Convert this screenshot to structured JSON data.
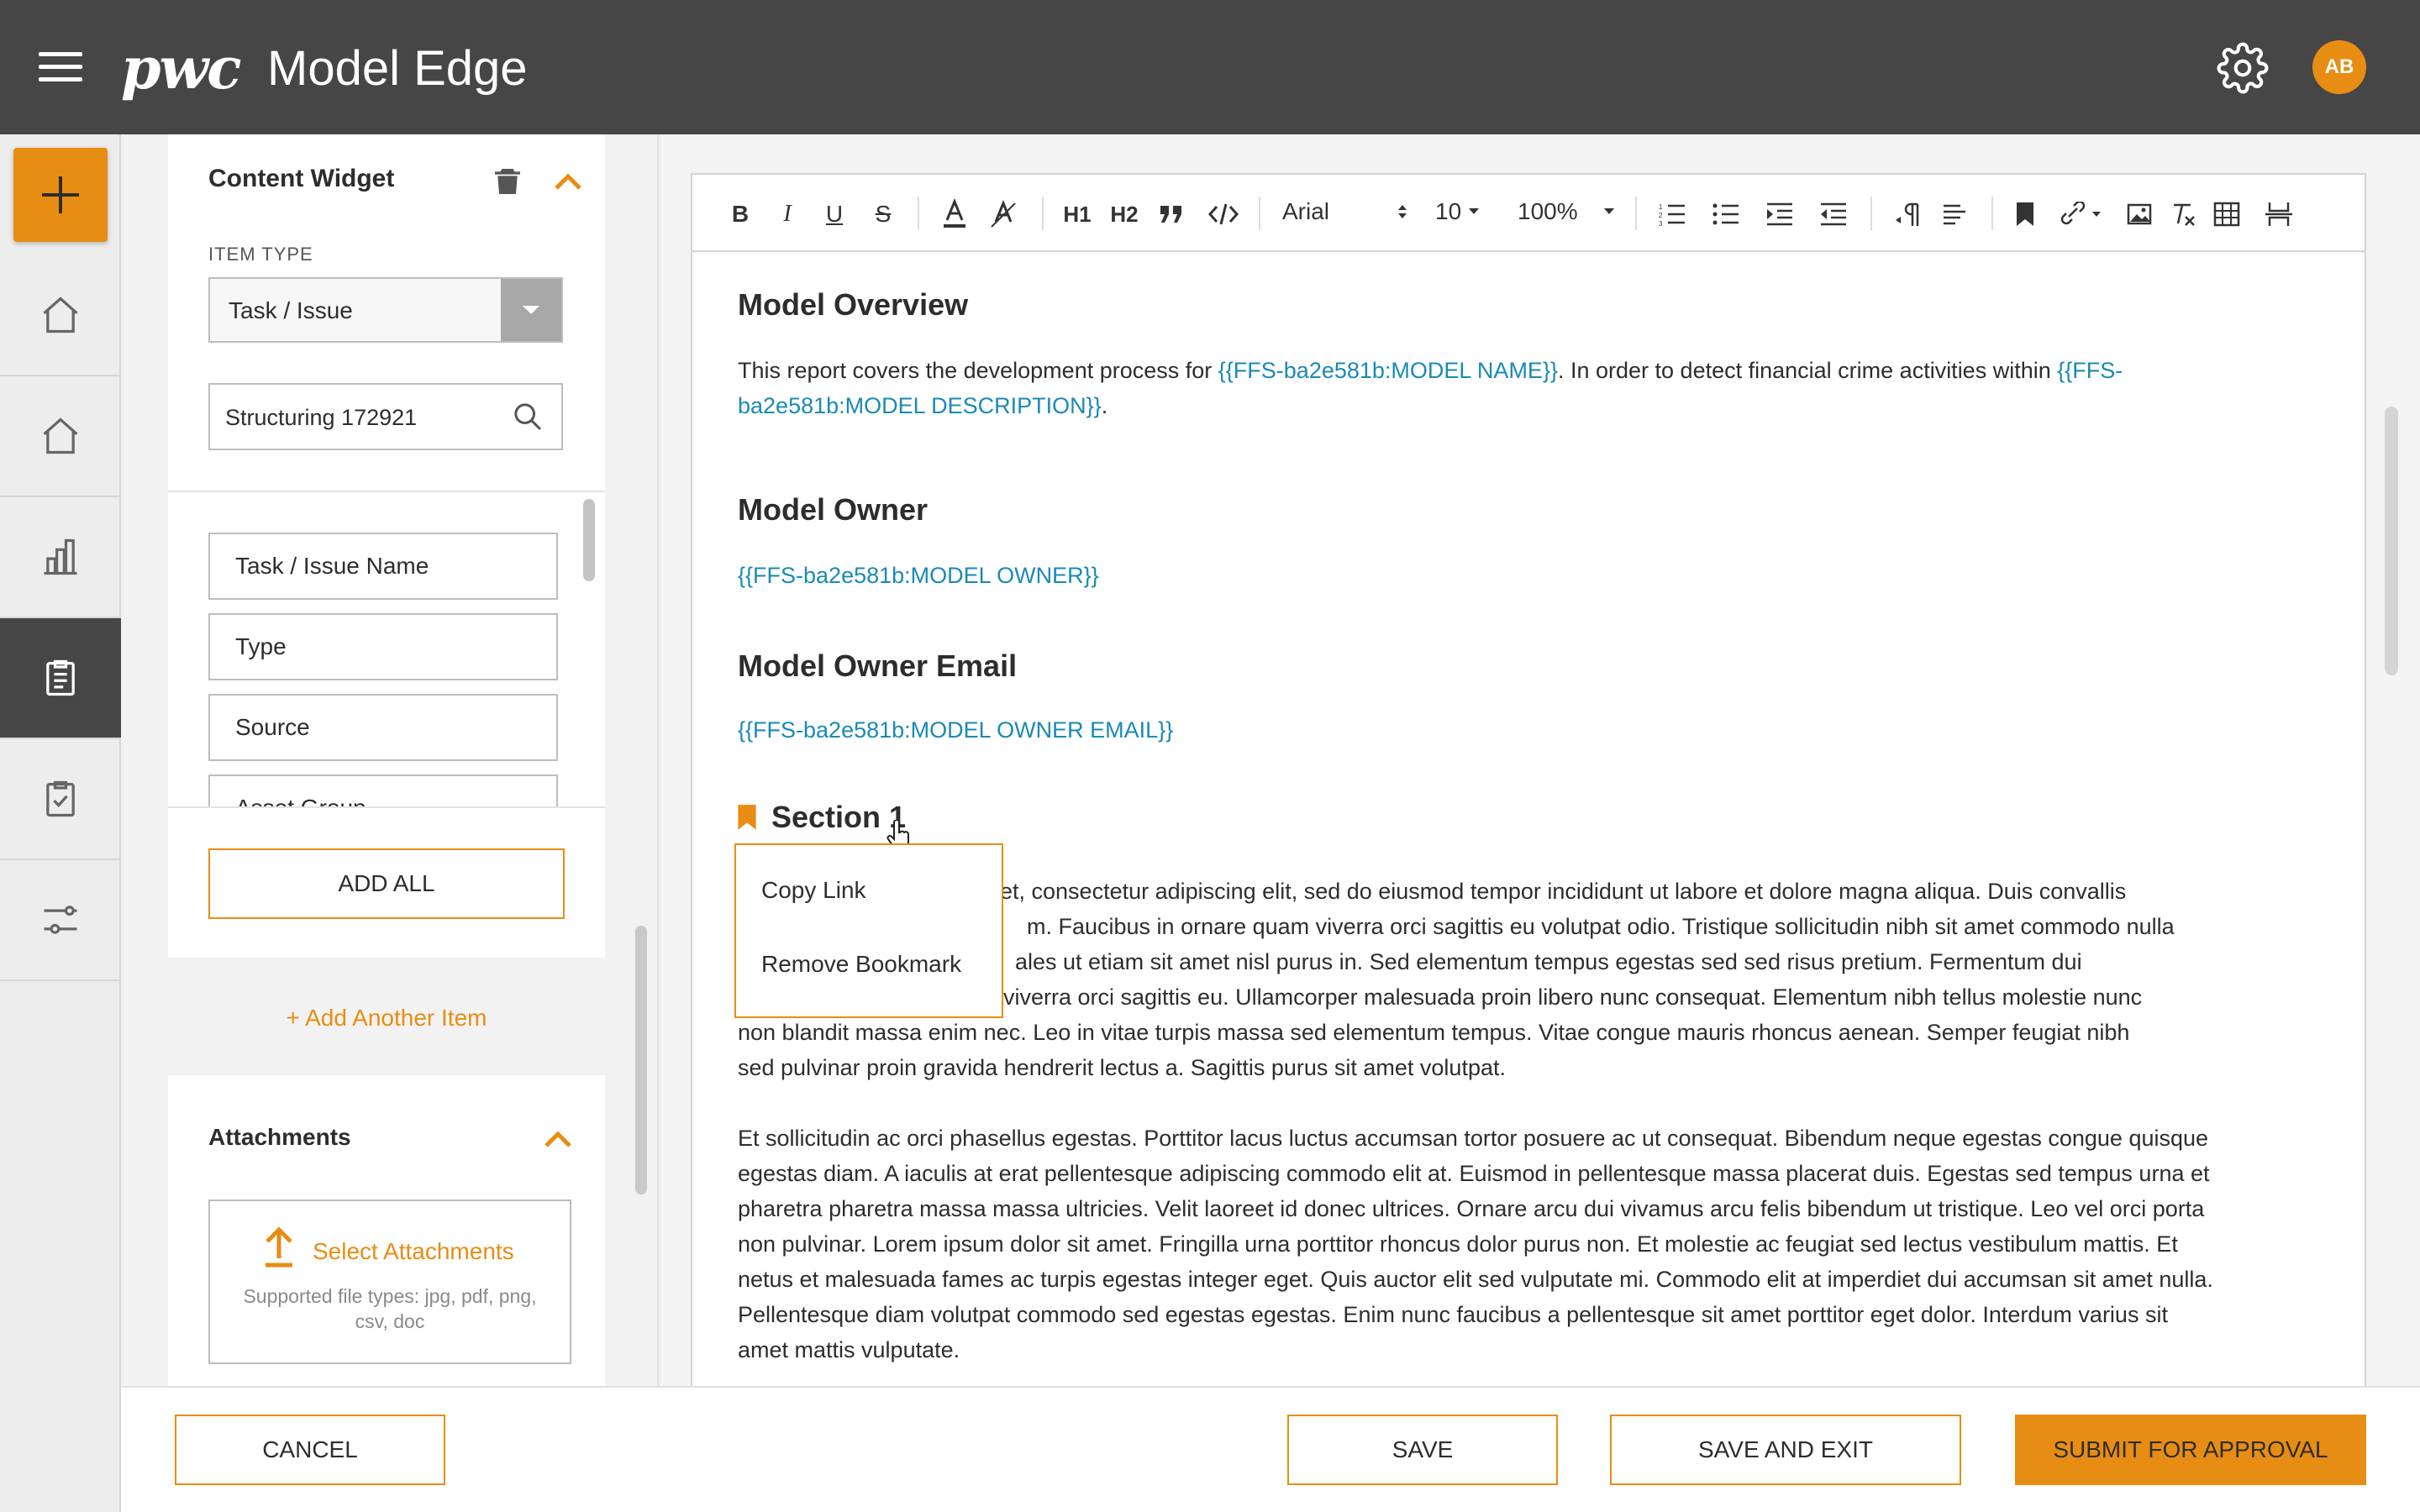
{
  "app": {
    "brand": "pwc",
    "title": "Model Edge",
    "user_initials": "AB",
    "accent": "#e88d14",
    "topbar_color": "#464646"
  },
  "nav": {
    "items": [
      {
        "icon": "plus-icon"
      },
      {
        "icon": "home-icon"
      },
      {
        "icon": "home-outline-icon"
      },
      {
        "icon": "bar-chart-icon"
      },
      {
        "icon": "clipboard-icon",
        "active": true
      },
      {
        "icon": "clipboard-check-icon"
      },
      {
        "icon": "sliders-icon"
      }
    ]
  },
  "widget": {
    "title": "Content Widget",
    "item_type_label": "ITEM TYPE",
    "item_type_value": "Task / Issue",
    "search_value": "Structuring 172921",
    "fields": [
      "Task / Issue Name",
      "Type",
      "Source",
      "Asset Group"
    ],
    "add_all": "ADD ALL",
    "add_another": "+ Add Another Item"
  },
  "attachments": {
    "title": "Attachments",
    "select_label": "Select Attachments",
    "hint": "Supported file types: jpg, pdf, png, csv, doc"
  },
  "toolbar": {
    "font": "Arial",
    "size": "10",
    "zoom": "100%",
    "h1": "H1",
    "h2": "H2"
  },
  "document": {
    "overview_heading": "Model Overview",
    "overview_text_1": "This report covers the development process for ",
    "overview_token_1": "{{FFS-ba2e581b:MODEL NAME}}",
    "overview_text_2": ". In order to detect financial crime activities within ",
    "overview_token_2a": "{{FFS-",
    "overview_token_2b": "ba2e581b:MODEL DESCRIPTION}}",
    "overview_text_3": ".",
    "owner_heading": "Model Owner",
    "owner_token": "{{FFS-ba2e581b:MODEL OWNER}}",
    "email_heading": "Model Owner Email",
    "email_token": "{{FFS-ba2e581b:MODEL OWNER EMAIL}}",
    "section_heading": "Section 1",
    "section_lines": [
      "et, consectetur adipiscing elit, sed do eiusmod tempor incididunt ut labore et dolore magna aliqua. Duis convallis",
      "m. Faucibus in ornare quam viverra orci sagittis eu volutpat odio. Tristique sollicitudin nibh sit amet commodo nulla",
      "ales ut etiam sit amet nisl purus in. Sed elementum tempus egestas sed sed risus pretium. Fermentum dui",
      "viverra orci sagittis eu. Ullamcorper malesuada proin libero nunc consequat. Elementum nibh tellus molestie nunc",
      "non blandit massa enim nec. Leo in vitae turpis massa sed elementum tempus. Vitae congue mauris rhoncus aenean. Semper feugiat nibh",
      "sed pulvinar proin gravida hendrerit lectus a. Sagittis purus sit amet volutpat."
    ],
    "para2": "Et sollicitudin ac orci phasellus egestas. Porttitor lacus luctus accumsan tortor posuere ac ut consequat. Bibendum neque egestas congue quisque egestas diam. A iaculis at erat pellentesque adipiscing commodo elit at. Euismod in pellentesque massa placerat duis. Egestas sed tempus urna et pharetra pharetra massa massa ultricies. Velit laoreet id donec ultrices. Ornare arcu dui vivamus arcu felis bibendum ut tristique. Leo vel orci porta non pulvinar. Lorem ipsum dolor sit amet. Fringilla urna porttitor rhoncus dolor purus non. Et molestie ac feugiat sed lectus vestibulum mattis. Et netus et malesuada fames ac turpis egestas integer eget. Quis auctor elit sed vulputate mi. Commodo elit at imperdiet dui accumsan sit amet nulla. Pellentesque diam volutpat commodo sed egestas egestas. Enim nunc faucibus a pellentesque sit amet porttitor eget dolor. Interdum varius sit amet mattis vulputate."
  },
  "popup": {
    "copy_link": "Copy Link",
    "remove_bookmark": "Remove Bookmark"
  },
  "footer": {
    "cancel": "CANCEL",
    "save": "SAVE",
    "save_exit": "SAVE AND EXIT",
    "submit": "SUBMIT FOR APPROVAL"
  }
}
